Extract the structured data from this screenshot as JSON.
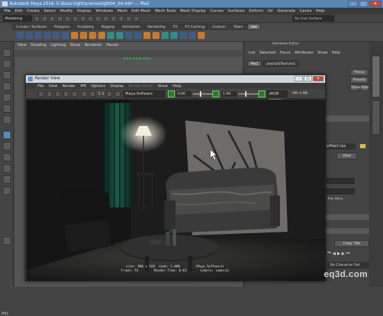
{
  "window_title": "Autodesk Maya 2016: E:\\Basic\\light\\scenes\\light04_04.mb* --- file2",
  "menubar": [
    "File",
    "Edit",
    "Create",
    "Select",
    "Modify",
    "Display",
    "Windows",
    "Mesh",
    "Edit Mesh",
    "Mesh Tools",
    "Mesh Display",
    "Curves",
    "Surfaces",
    "Deform",
    "UV",
    "Generate",
    "Cache",
    "Help"
  ],
  "mode_select": "Modeling",
  "live_surface": "No Live Surface",
  "shelf_tabs": [
    "Curves / Surfaces",
    "Polygons",
    "Sculpting",
    "Rigging",
    "Animation",
    "Rendering",
    "FX",
    "FX Caching",
    "Custom",
    "XGen",
    "test"
  ],
  "shelf_active": "test",
  "viewport_menu": [
    "View",
    "Shading",
    "Lighting",
    "Show",
    "Renderer",
    "Panels"
  ],
  "viewport_green": "### ### ###",
  "attr_header": "Attribute Editor",
  "attr_menu": [
    "List",
    "Selected",
    "Focus",
    "Attributes",
    "Show",
    "Help"
  ],
  "attr_tabs": [
    "file2",
    "place2dTexture1"
  ],
  "attr_buttons": {
    "focus": "Focus",
    "presets": "Presets",
    "show": "Show",
    "hide": "Hide"
  },
  "texture_path": "\\pMap1.tga",
  "view_button": "View",
  "file_attrs_label": "r File Attrs",
  "copy_tab": "Copy Tab",
  "no_character_set": "No Character Set",
  "mel_label": "MEL",
  "render_view": {
    "title": "Render View",
    "menu": [
      "File",
      "View",
      "Render",
      "IPR",
      "Options",
      "Display",
      "Show",
      "Help"
    ],
    "menu_dim": "Render Panel",
    "ratio_label": "1:1",
    "renderer": "Maya Software",
    "exposure": "0.00",
    "gamma": "1.00",
    "color_space": "sRGB gamma",
    "ipr_label": "IPR: 0 MB",
    "status_lines": [
      "size: 960 x 540  zoom: 1.000        (Maya Software)",
      "Frame: 51        Render Time: 0:03       Camera: camera1"
    ]
  },
  "watermark": "eq3d.com"
}
